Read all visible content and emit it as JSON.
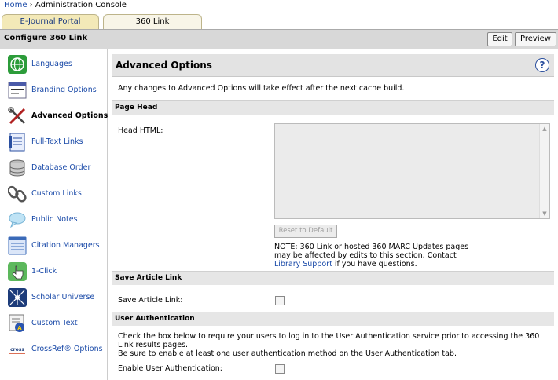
{
  "breadcrumb": {
    "home": "Home",
    "separator": "›",
    "current": "Administration Console"
  },
  "tabs": [
    {
      "label": "E-Journal Portal"
    },
    {
      "label": "360 Link"
    }
  ],
  "titlebar": {
    "title": "Configure 360 Link",
    "edit_label": "Edit",
    "preview_label": "Preview"
  },
  "sidebar": {
    "items": [
      {
        "label": "Languages",
        "icon": "globe-icon"
      },
      {
        "label": "Branding Options",
        "icon": "branding-icon"
      },
      {
        "label": "Advanced Options",
        "icon": "tools-icon",
        "active": true
      },
      {
        "label": "Full-Text Links",
        "icon": "document-icon"
      },
      {
        "label": "Database Order",
        "icon": "database-icon"
      },
      {
        "label": "Custom Links",
        "icon": "chain-link-icon"
      },
      {
        "label": "Public Notes",
        "icon": "speech-bubble-icon"
      },
      {
        "label": "Citation Managers",
        "icon": "list-icon"
      },
      {
        "label": "1-Click",
        "icon": "pointer-hand-icon"
      },
      {
        "label": "Scholar Universe",
        "icon": "network-icon"
      },
      {
        "label": "Custom Text",
        "icon": "text-icon"
      },
      {
        "label": "CrossRef® Options",
        "icon": "crossref-icon"
      }
    ]
  },
  "main": {
    "title": "Advanced Options",
    "help_symbol": "?",
    "notice": "Any changes to Advanced Options will take effect after the next cache build.",
    "page_head": {
      "section_title": "Page Head",
      "field_label": "Head HTML:",
      "value": "",
      "reset_label": "Reset to Default",
      "note_line1": "NOTE: 360 Link or hosted 360 MARC Updates pages",
      "note_line2": "may be affected by edits to this section. Contact",
      "note_link": "Library Support",
      "note_line3_rest": " if you have questions."
    },
    "save_article": {
      "section_title": "Save Article Link",
      "field_label": "Save Article Link:",
      "checked": false
    },
    "user_auth": {
      "section_title": "User Authentication",
      "text1": "Check the box below to require your users to log in to the User Authentication service prior to accessing the 360 Link results pages.",
      "text2": "Be sure to enable at least one user authentication method on the User Authentication tab.",
      "field_label": "Enable User Authentication:",
      "checked": false
    }
  }
}
